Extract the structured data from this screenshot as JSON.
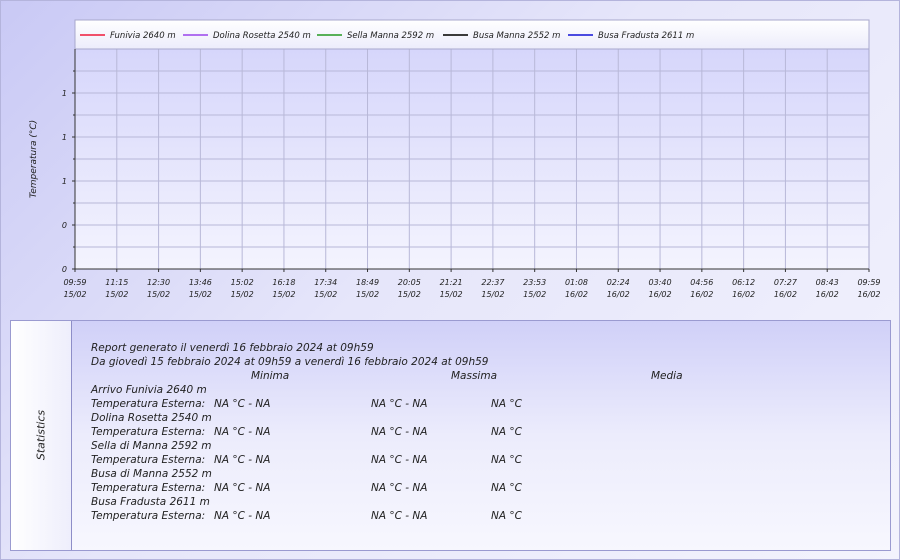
{
  "chart_data": {
    "type": "line",
    "ylabel": "Temperatura (°C)",
    "y_tick_labels": [
      "0",
      "0",
      "1",
      "1",
      "1"
    ],
    "ylim": [
      0,
      1
    ],
    "grid": true,
    "legend_position": "top",
    "x_tick_labels": [
      {
        "time": "09:59",
        "date": "15/02"
      },
      {
        "time": "11:15",
        "date": "15/02"
      },
      {
        "time": "12:30",
        "date": "15/02"
      },
      {
        "time": "13:46",
        "date": "15/02"
      },
      {
        "time": "15:02",
        "date": "15/02"
      },
      {
        "time": "16:18",
        "date": "15/02"
      },
      {
        "time": "17:34",
        "date": "15/02"
      },
      {
        "time": "18:49",
        "date": "15/02"
      },
      {
        "time": "20:05",
        "date": "15/02"
      },
      {
        "time": "21:21",
        "date": "15/02"
      },
      {
        "time": "22:37",
        "date": "15/02"
      },
      {
        "time": "23:53",
        "date": "15/02"
      },
      {
        "time": "01:08",
        "date": "16/02"
      },
      {
        "time": "02:24",
        "date": "16/02"
      },
      {
        "time": "03:40",
        "date": "16/02"
      },
      {
        "time": "04:56",
        "date": "16/02"
      },
      {
        "time": "06:12",
        "date": "16/02"
      },
      {
        "time": "07:27",
        "date": "16/02"
      },
      {
        "time": "08:43",
        "date": "16/02"
      },
      {
        "time": "09:59",
        "date": "16/02"
      }
    ],
    "series": [
      {
        "name": "Funivia 2640 m",
        "color": "#f0506a",
        "values": []
      },
      {
        "name": "Dolina Rosetta 2540 m",
        "color": "#b070f0",
        "values": []
      },
      {
        "name": "Sella Manna 2592 m",
        "color": "#58b058",
        "values": []
      },
      {
        "name": "Busa Manna 2552 m",
        "color": "#3a3a3a",
        "values": []
      },
      {
        "name": "Busa Fradusta 2611 m",
        "color": "#4a4ae0",
        "values": []
      }
    ]
  },
  "statistics": {
    "side_label": "Statistics",
    "report_line": "Report generato il  venerdì 16 febbraio 2024 at 09h59",
    "period_line": "Da giovedì 15 febbraio 2024 at 09h59 a venerdì 16 febbraio 2024 at 09h59",
    "col_min": "Minima",
    "col_max": "Massima",
    "col_avg": "Media",
    "stations": [
      {
        "name": "Arrivo Funivia 2640 m",
        "row_label": "Temperatura Esterna:",
        "min": "NA °C - NA",
        "max": "NA °C - NA",
        "avg": "NA °C"
      },
      {
        "name": "Dolina Rosetta 2540 m",
        "row_label": "Temperatura Esterna:",
        "min": "NA °C - NA",
        "max": "NA °C - NA",
        "avg": "NA °C"
      },
      {
        "name": "Sella di Manna 2592 m",
        "row_label": "Temperatura Esterna:",
        "min": "NA °C - NA",
        "max": "NA °C - NA",
        "avg": "NA °C"
      },
      {
        "name": "Busa di Manna 2552 m",
        "row_label": "Temperatura Esterna:",
        "min": "NA °C - NA",
        "max": "NA °C - NA",
        "avg": "NA °C"
      },
      {
        "name": "Busa Fradusta 2611 m",
        "row_label": "Temperatura Esterna:",
        "min": "NA °C - NA",
        "max": "NA °C - NA",
        "avg": "NA °C"
      }
    ]
  }
}
